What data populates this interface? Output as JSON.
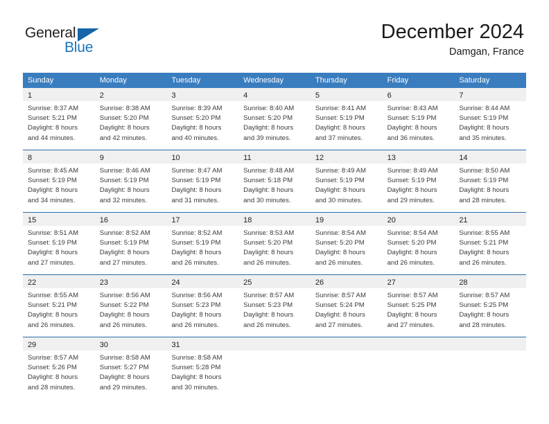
{
  "brand": {
    "name_part1": "General",
    "name_part2": "Blue",
    "triangle_icon": "brand-triangle-icon",
    "colors": {
      "general_text": "#231f20",
      "blue_text": "#1b75bb",
      "triangle": "#1565a8"
    }
  },
  "header": {
    "title": "December 2024",
    "subtitle": "Damgan, France"
  },
  "theme": {
    "header_row_bg": "#3a7dbf",
    "header_row_text": "#ffffff",
    "row_divider": "#2a6ba8",
    "daynum_band_bg": "#f0f0f0",
    "cell_bg": "#ffffff",
    "body_text": "#3a3a3a"
  },
  "weekdays": [
    "Sunday",
    "Monday",
    "Tuesday",
    "Wednesday",
    "Thursday",
    "Friday",
    "Saturday"
  ],
  "weeks": [
    {
      "days": [
        {
          "day": "1",
          "sunrise": "Sunrise: 8:37 AM",
          "sunset": "Sunset: 5:21 PM",
          "daylight1": "Daylight: 8 hours",
          "daylight2": "and 44 minutes."
        },
        {
          "day": "2",
          "sunrise": "Sunrise: 8:38 AM",
          "sunset": "Sunset: 5:20 PM",
          "daylight1": "Daylight: 8 hours",
          "daylight2": "and 42 minutes."
        },
        {
          "day": "3",
          "sunrise": "Sunrise: 8:39 AM",
          "sunset": "Sunset: 5:20 PM",
          "daylight1": "Daylight: 8 hours",
          "daylight2": "and 40 minutes."
        },
        {
          "day": "4",
          "sunrise": "Sunrise: 8:40 AM",
          "sunset": "Sunset: 5:20 PM",
          "daylight1": "Daylight: 8 hours",
          "daylight2": "and 39 minutes."
        },
        {
          "day": "5",
          "sunrise": "Sunrise: 8:41 AM",
          "sunset": "Sunset: 5:19 PM",
          "daylight1": "Daylight: 8 hours",
          "daylight2": "and 37 minutes."
        },
        {
          "day": "6",
          "sunrise": "Sunrise: 8:43 AM",
          "sunset": "Sunset: 5:19 PM",
          "daylight1": "Daylight: 8 hours",
          "daylight2": "and 36 minutes."
        },
        {
          "day": "7",
          "sunrise": "Sunrise: 8:44 AM",
          "sunset": "Sunset: 5:19 PM",
          "daylight1": "Daylight: 8 hours",
          "daylight2": "and 35 minutes."
        }
      ]
    },
    {
      "days": [
        {
          "day": "8",
          "sunrise": "Sunrise: 8:45 AM",
          "sunset": "Sunset: 5:19 PM",
          "daylight1": "Daylight: 8 hours",
          "daylight2": "and 34 minutes."
        },
        {
          "day": "9",
          "sunrise": "Sunrise: 8:46 AM",
          "sunset": "Sunset: 5:19 PM",
          "daylight1": "Daylight: 8 hours",
          "daylight2": "and 32 minutes."
        },
        {
          "day": "10",
          "sunrise": "Sunrise: 8:47 AM",
          "sunset": "Sunset: 5:19 PM",
          "daylight1": "Daylight: 8 hours",
          "daylight2": "and 31 minutes."
        },
        {
          "day": "11",
          "sunrise": "Sunrise: 8:48 AM",
          "sunset": "Sunset: 5:18 PM",
          "daylight1": "Daylight: 8 hours",
          "daylight2": "and 30 minutes."
        },
        {
          "day": "12",
          "sunrise": "Sunrise: 8:49 AM",
          "sunset": "Sunset: 5:19 PM",
          "daylight1": "Daylight: 8 hours",
          "daylight2": "and 30 minutes."
        },
        {
          "day": "13",
          "sunrise": "Sunrise: 8:49 AM",
          "sunset": "Sunset: 5:19 PM",
          "daylight1": "Daylight: 8 hours",
          "daylight2": "and 29 minutes."
        },
        {
          "day": "14",
          "sunrise": "Sunrise: 8:50 AM",
          "sunset": "Sunset: 5:19 PM",
          "daylight1": "Daylight: 8 hours",
          "daylight2": "and 28 minutes."
        }
      ]
    },
    {
      "days": [
        {
          "day": "15",
          "sunrise": "Sunrise: 8:51 AM",
          "sunset": "Sunset: 5:19 PM",
          "daylight1": "Daylight: 8 hours",
          "daylight2": "and 27 minutes."
        },
        {
          "day": "16",
          "sunrise": "Sunrise: 8:52 AM",
          "sunset": "Sunset: 5:19 PM",
          "daylight1": "Daylight: 8 hours",
          "daylight2": "and 27 minutes."
        },
        {
          "day": "17",
          "sunrise": "Sunrise: 8:52 AM",
          "sunset": "Sunset: 5:19 PM",
          "daylight1": "Daylight: 8 hours",
          "daylight2": "and 26 minutes."
        },
        {
          "day": "18",
          "sunrise": "Sunrise: 8:53 AM",
          "sunset": "Sunset: 5:20 PM",
          "daylight1": "Daylight: 8 hours",
          "daylight2": "and 26 minutes."
        },
        {
          "day": "19",
          "sunrise": "Sunrise: 8:54 AM",
          "sunset": "Sunset: 5:20 PM",
          "daylight1": "Daylight: 8 hours",
          "daylight2": "and 26 minutes."
        },
        {
          "day": "20",
          "sunrise": "Sunrise: 8:54 AM",
          "sunset": "Sunset: 5:20 PM",
          "daylight1": "Daylight: 8 hours",
          "daylight2": "and 26 minutes."
        },
        {
          "day": "21",
          "sunrise": "Sunrise: 8:55 AM",
          "sunset": "Sunset: 5:21 PM",
          "daylight1": "Daylight: 8 hours",
          "daylight2": "and 26 minutes."
        }
      ]
    },
    {
      "days": [
        {
          "day": "22",
          "sunrise": "Sunrise: 8:55 AM",
          "sunset": "Sunset: 5:21 PM",
          "daylight1": "Daylight: 8 hours",
          "daylight2": "and 26 minutes."
        },
        {
          "day": "23",
          "sunrise": "Sunrise: 8:56 AM",
          "sunset": "Sunset: 5:22 PM",
          "daylight1": "Daylight: 8 hours",
          "daylight2": "and 26 minutes."
        },
        {
          "day": "24",
          "sunrise": "Sunrise: 8:56 AM",
          "sunset": "Sunset: 5:23 PM",
          "daylight1": "Daylight: 8 hours",
          "daylight2": "and 26 minutes."
        },
        {
          "day": "25",
          "sunrise": "Sunrise: 8:57 AM",
          "sunset": "Sunset: 5:23 PM",
          "daylight1": "Daylight: 8 hours",
          "daylight2": "and 26 minutes."
        },
        {
          "day": "26",
          "sunrise": "Sunrise: 8:57 AM",
          "sunset": "Sunset: 5:24 PM",
          "daylight1": "Daylight: 8 hours",
          "daylight2": "and 27 minutes."
        },
        {
          "day": "27",
          "sunrise": "Sunrise: 8:57 AM",
          "sunset": "Sunset: 5:25 PM",
          "daylight1": "Daylight: 8 hours",
          "daylight2": "and 27 minutes."
        },
        {
          "day": "28",
          "sunrise": "Sunrise: 8:57 AM",
          "sunset": "Sunset: 5:25 PM",
          "daylight1": "Daylight: 8 hours",
          "daylight2": "and 28 minutes."
        }
      ]
    },
    {
      "days": [
        {
          "day": "29",
          "sunrise": "Sunrise: 8:57 AM",
          "sunset": "Sunset: 5:26 PM",
          "daylight1": "Daylight: 8 hours",
          "daylight2": "and 28 minutes."
        },
        {
          "day": "30",
          "sunrise": "Sunrise: 8:58 AM",
          "sunset": "Sunset: 5:27 PM",
          "daylight1": "Daylight: 8 hours",
          "daylight2": "and 29 minutes."
        },
        {
          "day": "31",
          "sunrise": "Sunrise: 8:58 AM",
          "sunset": "Sunset: 5:28 PM",
          "daylight1": "Daylight: 8 hours",
          "daylight2": "and 30 minutes."
        },
        {
          "day": "",
          "sunrise": "",
          "sunset": "",
          "daylight1": "",
          "daylight2": ""
        },
        {
          "day": "",
          "sunrise": "",
          "sunset": "",
          "daylight1": "",
          "daylight2": ""
        },
        {
          "day": "",
          "sunrise": "",
          "sunset": "",
          "daylight1": "",
          "daylight2": ""
        },
        {
          "day": "",
          "sunrise": "",
          "sunset": "",
          "daylight1": "",
          "daylight2": ""
        }
      ]
    }
  ]
}
